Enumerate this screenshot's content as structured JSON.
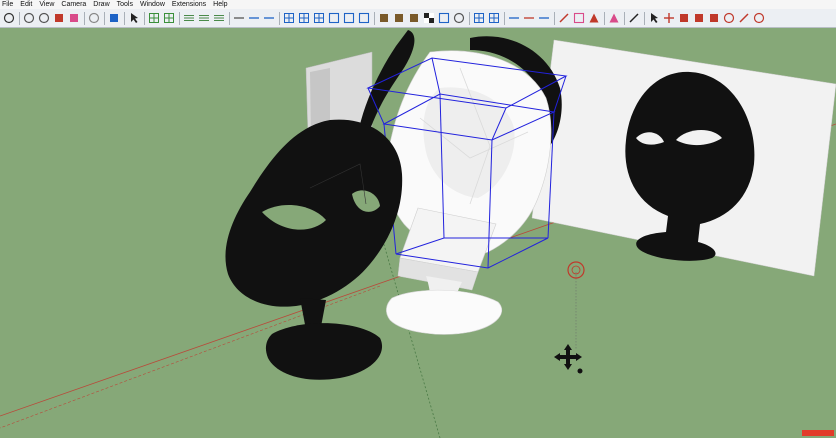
{
  "menu": {
    "items": [
      {
        "id": "file",
        "label": "File"
      },
      {
        "id": "edit",
        "label": "Edit"
      },
      {
        "id": "view",
        "label": "View"
      },
      {
        "id": "camera",
        "label": "Camera"
      },
      {
        "id": "draw",
        "label": "Draw"
      },
      {
        "id": "tools",
        "label": "Tools"
      },
      {
        "id": "window",
        "label": "Window"
      },
      {
        "id": "extensions",
        "label": "Extensions"
      },
      {
        "id": "help",
        "label": "Help"
      }
    ]
  },
  "toolbar": {
    "buttons": [
      {
        "icon": "orbit-icon",
        "color": "#333333"
      },
      {
        "sep": true
      },
      {
        "icon": "zoom-icon",
        "color": "#555555"
      },
      {
        "icon": "zoom-extents-icon",
        "color": "#555555"
      },
      {
        "icon": "paint-bucket-icon",
        "color": "#c0392b"
      },
      {
        "icon": "eraser-icon",
        "color": "#d94b8a"
      },
      {
        "sep": true
      },
      {
        "icon": "sphere-icon",
        "color": "#888888"
      },
      {
        "sep": true
      },
      {
        "icon": "footprints-icon",
        "color": "#1e63c6"
      },
      {
        "sep": true
      },
      {
        "icon": "select-arrow-icon",
        "color": "#222222"
      },
      {
        "sep": true
      },
      {
        "icon": "component-icon",
        "color": "#3a8f3a"
      },
      {
        "icon": "group-icon",
        "color": "#3a8f3a"
      },
      {
        "sep": true
      },
      {
        "icon": "layers-icon",
        "color": "#4a8a4a"
      },
      {
        "icon": "layers-add-icon",
        "color": "#4a8a4a"
      },
      {
        "icon": "layers-remove-icon",
        "color": "#4a8a4a"
      },
      {
        "sep": true
      },
      {
        "icon": "line-style-icon",
        "color": "#555555"
      },
      {
        "icon": "line-dash-icon",
        "color": "#1e63c6"
      },
      {
        "icon": "line-dot-icon",
        "color": "#1e63c6"
      },
      {
        "sep": true
      },
      {
        "icon": "xray-icon",
        "color": "#1e63c6"
      },
      {
        "icon": "wireframe-icon",
        "color": "#1e63c6"
      },
      {
        "icon": "hidden-line-icon",
        "color": "#1e63c6"
      },
      {
        "icon": "shaded-icon",
        "color": "#1e63c6"
      },
      {
        "icon": "textured-icon",
        "color": "#1e63c6"
      },
      {
        "icon": "monochrome-icon",
        "color": "#1e63c6"
      },
      {
        "sep": true
      },
      {
        "icon": "iso-view-icon",
        "color": "#7a5a2a"
      },
      {
        "icon": "top-view-icon",
        "color": "#7a5a2a"
      },
      {
        "icon": "front-view-icon",
        "color": "#7a5a2a"
      },
      {
        "icon": "checker-icon",
        "color": "#222222"
      },
      {
        "icon": "shadow-icon",
        "color": "#1e63c6"
      },
      {
        "icon": "fog-icon",
        "color": "#555555"
      },
      {
        "sep": true
      },
      {
        "icon": "section-plane-icon",
        "color": "#1e63c6"
      },
      {
        "icon": "section-cut-icon",
        "color": "#1e63c6"
      },
      {
        "sep": true
      },
      {
        "icon": "axes-icon",
        "color": "#1e63c6"
      },
      {
        "icon": "guides-icon",
        "color": "#c0392b"
      },
      {
        "icon": "dimension-icon",
        "color": "#1e63c6"
      },
      {
        "sep": true
      },
      {
        "icon": "pencil-icon",
        "color": "#c0392b"
      },
      {
        "icon": "tag-icon",
        "color": "#d94b8a"
      },
      {
        "icon": "pyramid-icon",
        "color": "#c0392b"
      },
      {
        "sep": true
      },
      {
        "icon": "polygon-icon",
        "color": "#d94b8a"
      },
      {
        "sep": true
      },
      {
        "icon": "knife-icon",
        "color": "#222222"
      },
      {
        "sep": true
      },
      {
        "icon": "cursor-icon",
        "color": "#222222"
      },
      {
        "icon": "move-icon",
        "color": "#c0392b"
      },
      {
        "icon": "hat-icon",
        "color": "#c0392b"
      },
      {
        "icon": "paint-icon",
        "color": "#c0392b"
      },
      {
        "icon": "box-icon",
        "color": "#c0392b"
      },
      {
        "icon": "crescent-icon",
        "color": "#c0392b"
      },
      {
        "icon": "feather-icon",
        "color": "#c0392b"
      },
      {
        "icon": "gear-icon",
        "color": "#c0392b"
      }
    ]
  },
  "scene": {
    "sky_color": "#86a878",
    "wall_color": "#f2f2f2",
    "selection_color": "#2222dd",
    "axis_red": "#c0392b",
    "axis_green": "#3d7a3a"
  },
  "status": {
    "indicator_color": "#e23c2a"
  }
}
